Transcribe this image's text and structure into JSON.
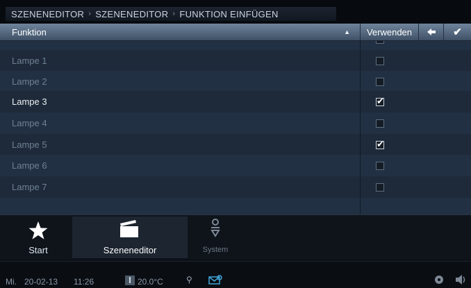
{
  "breadcrumb": [
    "SZENENEDITOR",
    "SZENENEDITOR",
    "FUNKTION EINFÜGEN"
  ],
  "header": {
    "function_label": "Funktion",
    "use_label": "Verwenden"
  },
  "rows": [
    {
      "name": "",
      "checked": false
    },
    {
      "name": "Lampe 1",
      "checked": false
    },
    {
      "name": "Lampe 2",
      "checked": false
    },
    {
      "name": "Lampe 3",
      "checked": true
    },
    {
      "name": "Lampe 4",
      "checked": false
    },
    {
      "name": "Lampe 5",
      "checked": true
    },
    {
      "name": "Lampe 6",
      "checked": false
    },
    {
      "name": "Lampe 7",
      "checked": false
    }
  ],
  "nav": {
    "start": "Start",
    "szenen": "Szeneneditor",
    "system": "System"
  },
  "status": {
    "day": "Mi.",
    "date": "20-02-13",
    "time": "11:26",
    "temperature": "20.0°C"
  },
  "icons": {
    "sort": "sort-up-icon",
    "back": "back-arrow-icon",
    "confirm": "checkmark-icon",
    "start": "star-icon",
    "szenen": "clapperboard-icon",
    "system": "system-icon",
    "thermo": "thermometer-icon",
    "pin": "pin-icon",
    "message": "message-icon",
    "settings": "settings-icon",
    "volume": "speaker-icon"
  }
}
